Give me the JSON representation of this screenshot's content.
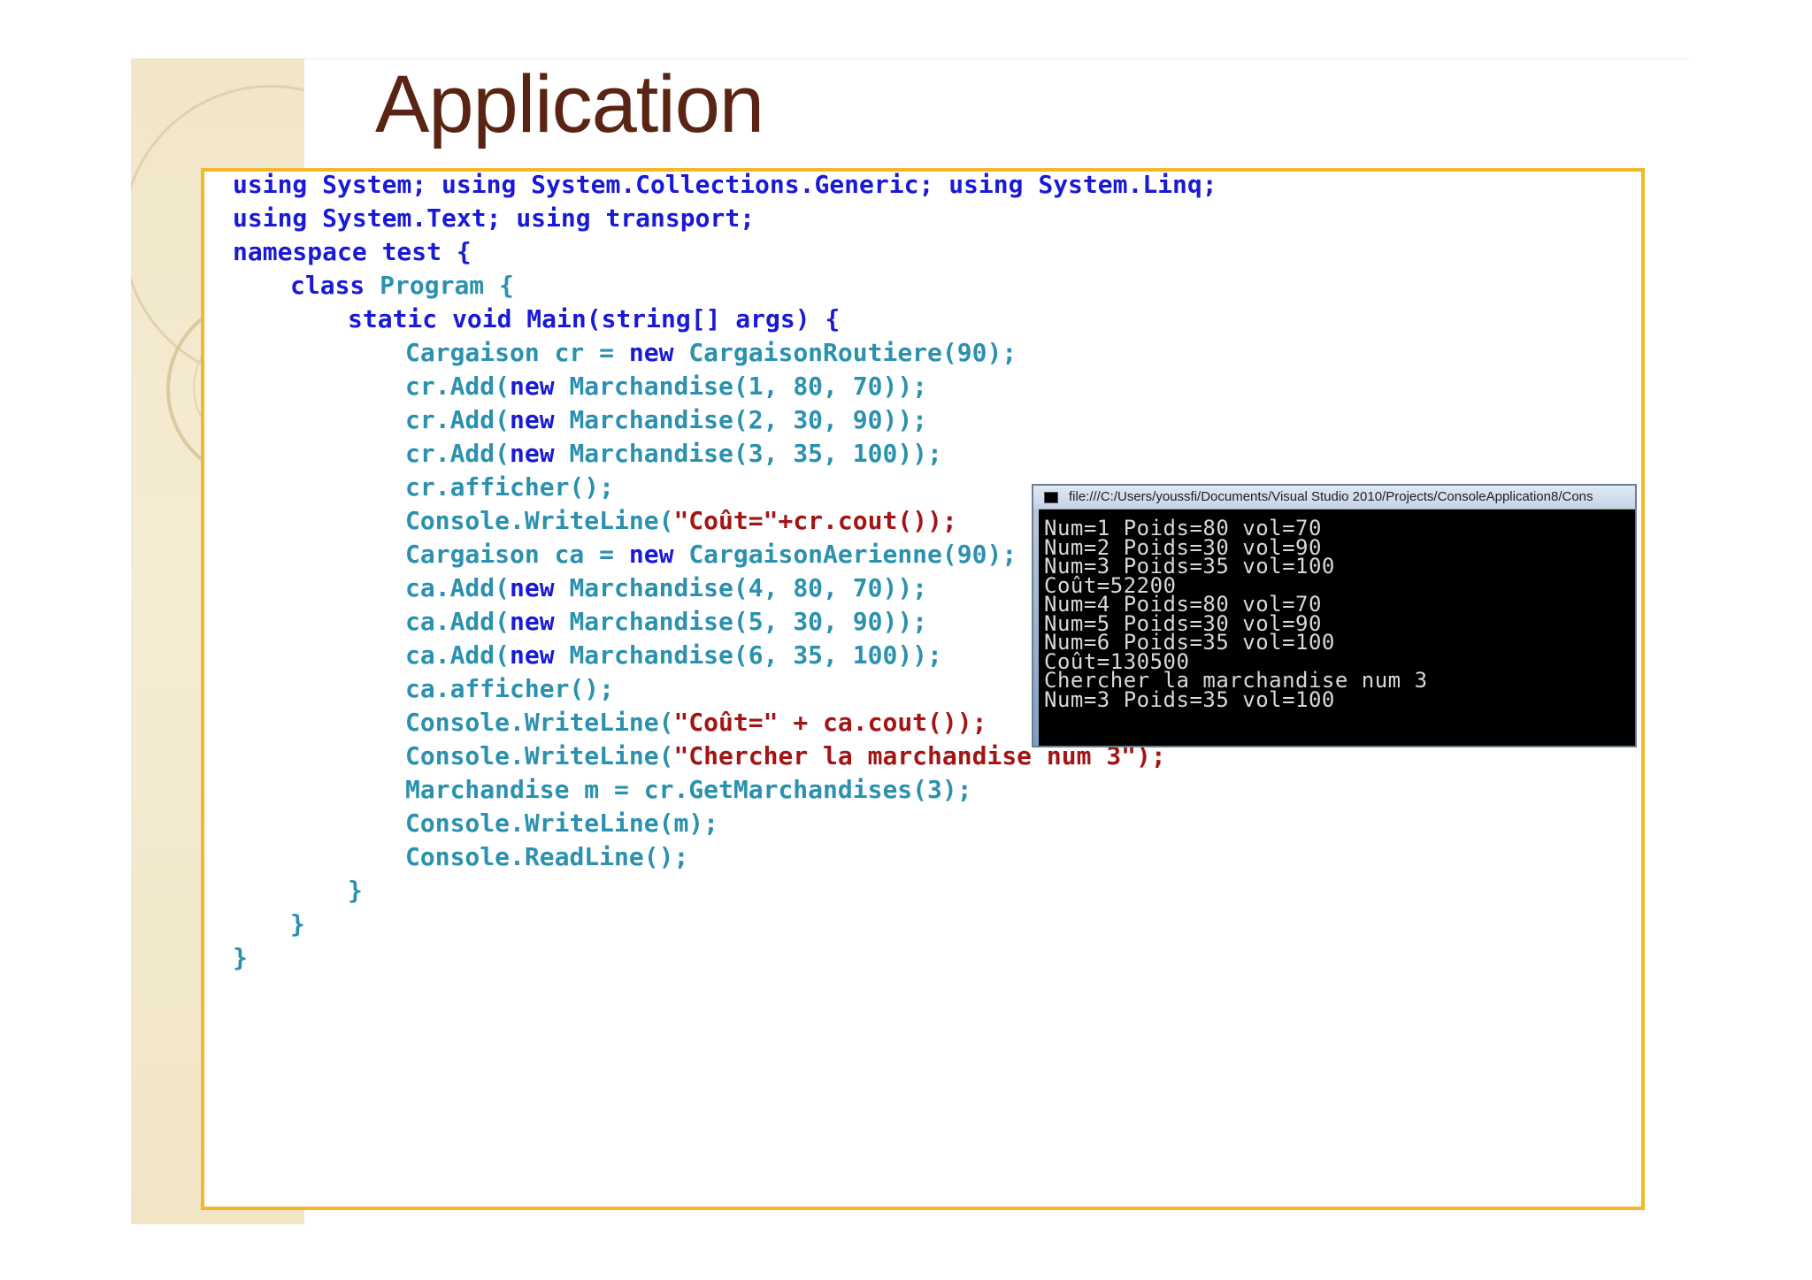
{
  "slide": {
    "title": "Application"
  },
  "code_lines": [
    {
      "indent": 0,
      "tokens": [
        [
          "kw",
          "using "
        ],
        [
          "kw",
          "System; "
        ],
        [
          "kw",
          "using "
        ],
        [
          "kw",
          "System.Collections.Generic; "
        ],
        [
          "kw",
          "using "
        ],
        [
          "kw",
          "System.Linq;"
        ]
      ]
    },
    {
      "indent": 0,
      "tokens": [
        [
          "kw",
          "using "
        ],
        [
          "kw",
          "System.Text; "
        ],
        [
          "kw",
          "using "
        ],
        [
          "kw",
          "transport;"
        ]
      ]
    },
    {
      "indent": 0,
      "tokens": [
        [
          "kw",
          "namespace "
        ],
        [
          "kw",
          "test {"
        ]
      ]
    },
    {
      "indent": 1,
      "tokens": [
        [
          "kw",
          "class "
        ],
        [
          "ty",
          "Program "
        ],
        [
          "pl",
          "{"
        ]
      ]
    },
    {
      "indent": 2,
      "tokens": [
        [
          "kw",
          "static void Main(string[] args) {"
        ]
      ]
    },
    {
      "indent": 3,
      "tokens": [
        [
          "ty",
          "Cargaison "
        ],
        [
          "pl",
          "cr = "
        ],
        [
          "kw",
          "new "
        ],
        [
          "ty",
          "CargaisonRoutiere"
        ],
        [
          "pl",
          "(90);"
        ]
      ]
    },
    {
      "indent": 3,
      "tokens": [
        [
          "pl",
          "cr.Add("
        ],
        [
          "kw",
          "new "
        ],
        [
          "ty",
          "Marchandise"
        ],
        [
          "pl",
          "(1, 80, 70));"
        ]
      ]
    },
    {
      "indent": 3,
      "tokens": [
        [
          "pl",
          "cr.Add("
        ],
        [
          "kw",
          "new "
        ],
        [
          "ty",
          "Marchandise"
        ],
        [
          "pl",
          "(2, 30, 90));"
        ]
      ]
    },
    {
      "indent": 3,
      "tokens": [
        [
          "pl",
          "cr.Add("
        ],
        [
          "kw",
          "new "
        ],
        [
          "ty",
          "Marchandise"
        ],
        [
          "pl",
          "(3, 35, 100));"
        ]
      ]
    },
    {
      "indent": 3,
      "tokens": [
        [
          "pl",
          "cr.afficher();"
        ]
      ]
    },
    {
      "indent": 3,
      "tokens": [
        [
          "ty",
          "Console"
        ],
        [
          "pl",
          ".WriteLine("
        ],
        [
          "st",
          "\"Coût=\"+cr.cout());"
        ]
      ]
    },
    {
      "indent": 3,
      "tokens": [
        [
          "ty",
          "Cargaison "
        ],
        [
          "pl",
          "ca = "
        ],
        [
          "kw",
          "new "
        ],
        [
          "ty",
          "CargaisonAerienne"
        ],
        [
          "pl",
          "(90);"
        ]
      ]
    },
    {
      "indent": 3,
      "tokens": [
        [
          "pl",
          "ca.Add("
        ],
        [
          "kw",
          "new "
        ],
        [
          "ty",
          "Marchandise"
        ],
        [
          "pl",
          "(4, 80, 70));"
        ]
      ]
    },
    {
      "indent": 3,
      "tokens": [
        [
          "pl",
          "ca.Add("
        ],
        [
          "kw",
          "new "
        ],
        [
          "ty",
          "Marchandise"
        ],
        [
          "pl",
          "(5, 30, 90));"
        ]
      ]
    },
    {
      "indent": 3,
      "tokens": [
        [
          "pl",
          "ca.Add("
        ],
        [
          "kw",
          "new "
        ],
        [
          "ty",
          "Marchandise"
        ],
        [
          "pl",
          "(6, 35, 100));"
        ]
      ]
    },
    {
      "indent": 3,
      "tokens": [
        [
          "pl",
          "ca.afficher();"
        ]
      ]
    },
    {
      "indent": 3,
      "tokens": [
        [
          "ty",
          "Console"
        ],
        [
          "pl",
          ".WriteLine("
        ],
        [
          "st",
          "\"Coût=\" + ca.cout());"
        ]
      ]
    },
    {
      "indent": 3,
      "tokens": [
        [
          "ty",
          "Console"
        ],
        [
          "pl",
          ".WriteLine("
        ],
        [
          "st",
          "\"Chercher la marchandise num 3\");"
        ]
      ]
    },
    {
      "indent": 3,
      "tokens": [
        [
          "ty",
          "Marchandise "
        ],
        [
          "pl",
          "m = cr.GetMarchandises(3);"
        ]
      ]
    },
    {
      "indent": 3,
      "tokens": [
        [
          "ty",
          "Console"
        ],
        [
          "pl",
          ".WriteLine(m);"
        ]
      ]
    },
    {
      "indent": 3,
      "tokens": [
        [
          "ty",
          "Console"
        ],
        [
          "pl",
          ".ReadLine();"
        ]
      ]
    },
    {
      "indent": 2,
      "tokens": [
        [
          "pl",
          "}"
        ]
      ]
    },
    {
      "indent": 1,
      "tokens": [
        [
          "pl",
          "}"
        ]
      ]
    },
    {
      "indent": 0,
      "tokens": [
        [
          "pl",
          "}"
        ]
      ]
    }
  ],
  "console": {
    "title": "file:///C:/Users/youssfi/Documents/Visual Studio 2010/Projects/ConsoleApplication8/Cons",
    "icon": "console-window-icon",
    "lines": [
      "Num=1 Poids=80 vol=70",
      "Num=2 Poids=30 vol=90",
      "Num=3 Poids=35 vol=100",
      "Coût=52200",
      "Num=4 Poids=80 vol=70",
      "Num=5 Poids=30 vol=90",
      "Num=6 Poids=35 vol=100",
      "Coût=130500",
      "Chercher la marchandise num 3",
      "Num=3 Poids=35 vol=100"
    ]
  },
  "colors": {
    "keyword": "#1a1ad6",
    "type": "#2b91af",
    "string": "#a31515",
    "frame": "#f3b82a",
    "title": "#5a2414"
  }
}
